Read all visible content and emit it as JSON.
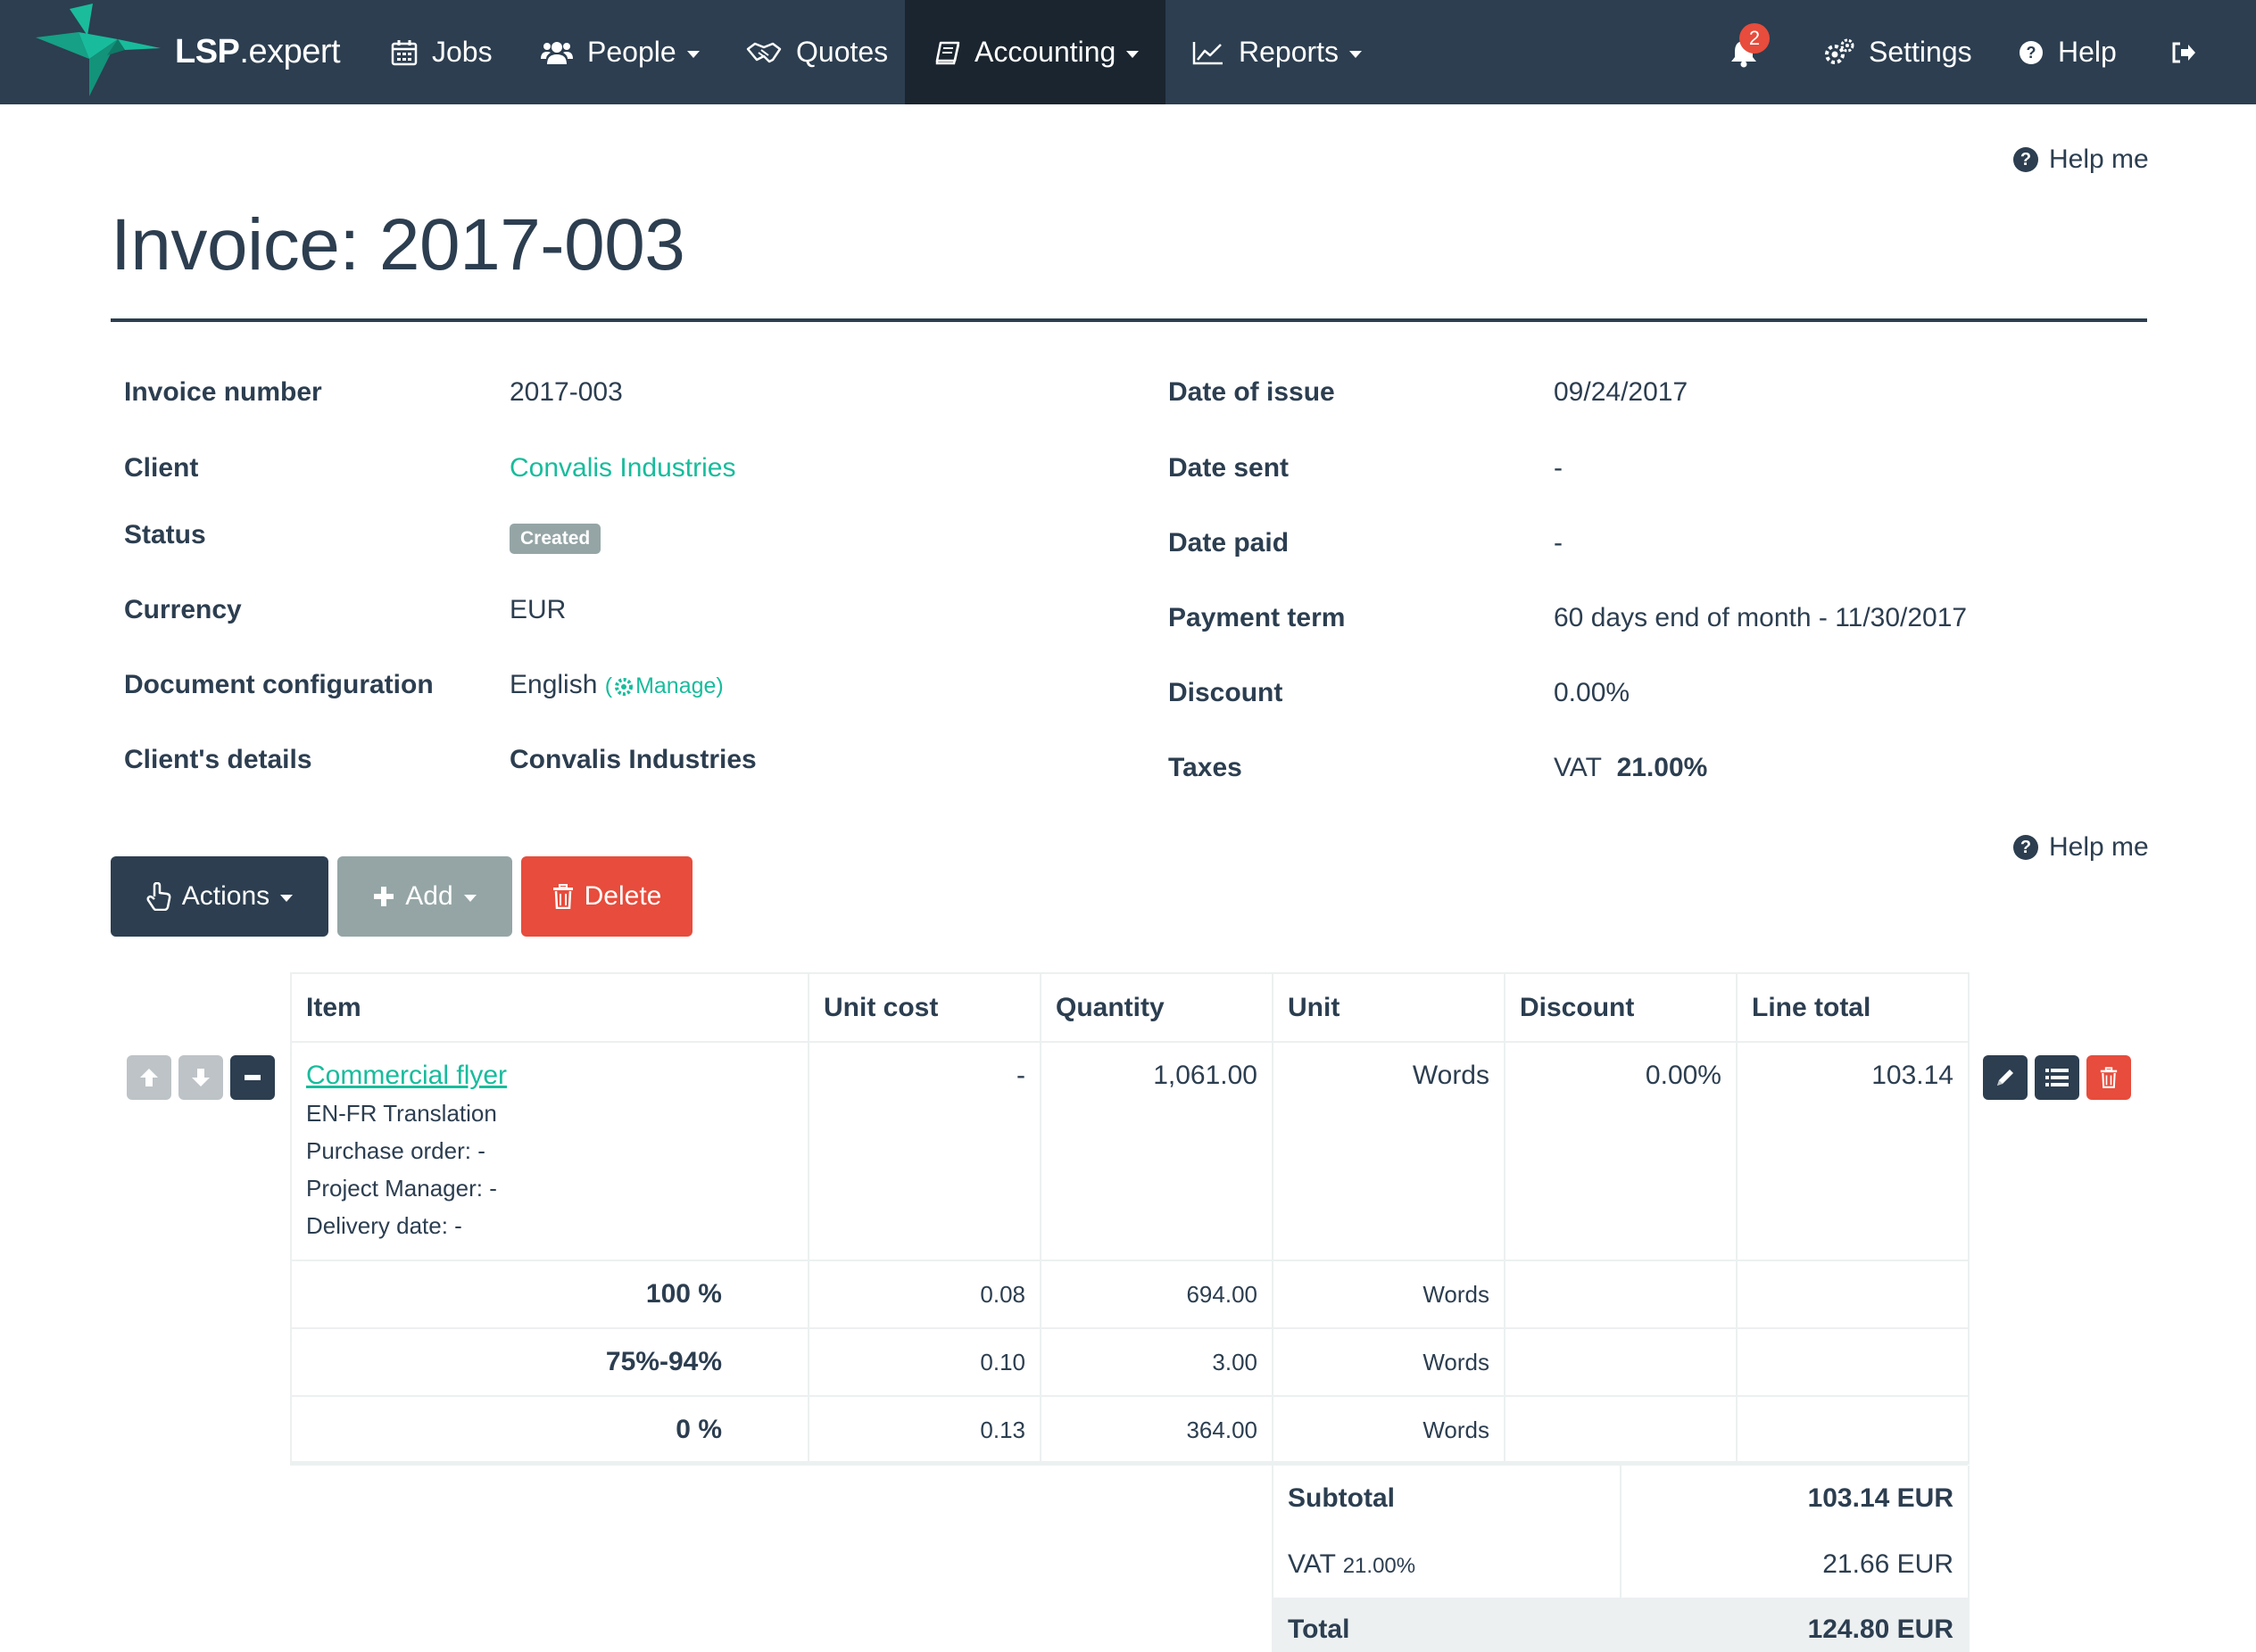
{
  "nav": {
    "brand_bold": "LSP",
    "brand_thin": ".expert",
    "jobs": "Jobs",
    "people": "People",
    "quotes": "Quotes",
    "accounting": "Accounting",
    "reports": "Reports",
    "notifications_count": "2",
    "settings": "Settings",
    "help": "Help"
  },
  "header": {
    "help_me": "Help me",
    "title": "Invoice: 2017-003"
  },
  "details": {
    "left": [
      {
        "label": "Invoice number",
        "value": "2017-003"
      },
      {
        "label": "Client",
        "value": "Convalis Industries"
      },
      {
        "label": "Status",
        "value": "Created"
      },
      {
        "label": "Currency",
        "value": "EUR"
      },
      {
        "label": "Document configuration",
        "value": "English",
        "manage_open": "(",
        "manage": "Manage)"
      },
      {
        "label": "Client's details",
        "value": "Convalis Industries"
      }
    ],
    "right": [
      {
        "label": "Date of issue",
        "value": "09/24/2017"
      },
      {
        "label": "Date sent",
        "value": "-"
      },
      {
        "label": "Date paid",
        "value": "-"
      },
      {
        "label": "Payment term",
        "value": "60 days end of month - 11/30/2017"
      },
      {
        "label": "Discount",
        "value": "0.00%"
      },
      {
        "label": "Taxes",
        "value_prefix": "VAT",
        "value": "21.00%"
      }
    ]
  },
  "actions": {
    "help_me": "Help me",
    "actions_label": "Actions",
    "add_label": "Add",
    "delete_label": "Delete"
  },
  "table": {
    "headers": [
      "Item",
      "Unit cost",
      "Quantity",
      "Unit",
      "Discount",
      "Line total"
    ],
    "item": {
      "name": "Commercial flyer",
      "details": [
        "EN-FR Translation",
        "Purchase order: -",
        "Project Manager: -",
        "Delivery date: -"
      ],
      "unit_cost": "-",
      "quantity": "1,061.00",
      "unit": "Words",
      "discount": "0.00%",
      "line_total": "103.14"
    },
    "tiers": [
      {
        "name": "100 %",
        "unit_cost": "0.08",
        "quantity": "694.00",
        "unit": "Words"
      },
      {
        "name": "75%-94%",
        "unit_cost": "0.10",
        "quantity": "3.00",
        "unit": "Words"
      },
      {
        "name": "0 %",
        "unit_cost": "0.13",
        "quantity": "364.00",
        "unit": "Words"
      }
    ]
  },
  "totals": {
    "subtotal_label": "Subtotal",
    "subtotal": "103.14 EUR",
    "vat_label": "VAT",
    "vat_rate": "21.00%",
    "vat": "21.66 EUR",
    "total_label": "Total",
    "total": "124.80 EUR"
  },
  "colors": {
    "navbar": "#2c3e50",
    "navbar_active": "#1a252f",
    "accent": "#18bc9c",
    "danger": "#e74c3c",
    "muted": "#95a5a6"
  }
}
